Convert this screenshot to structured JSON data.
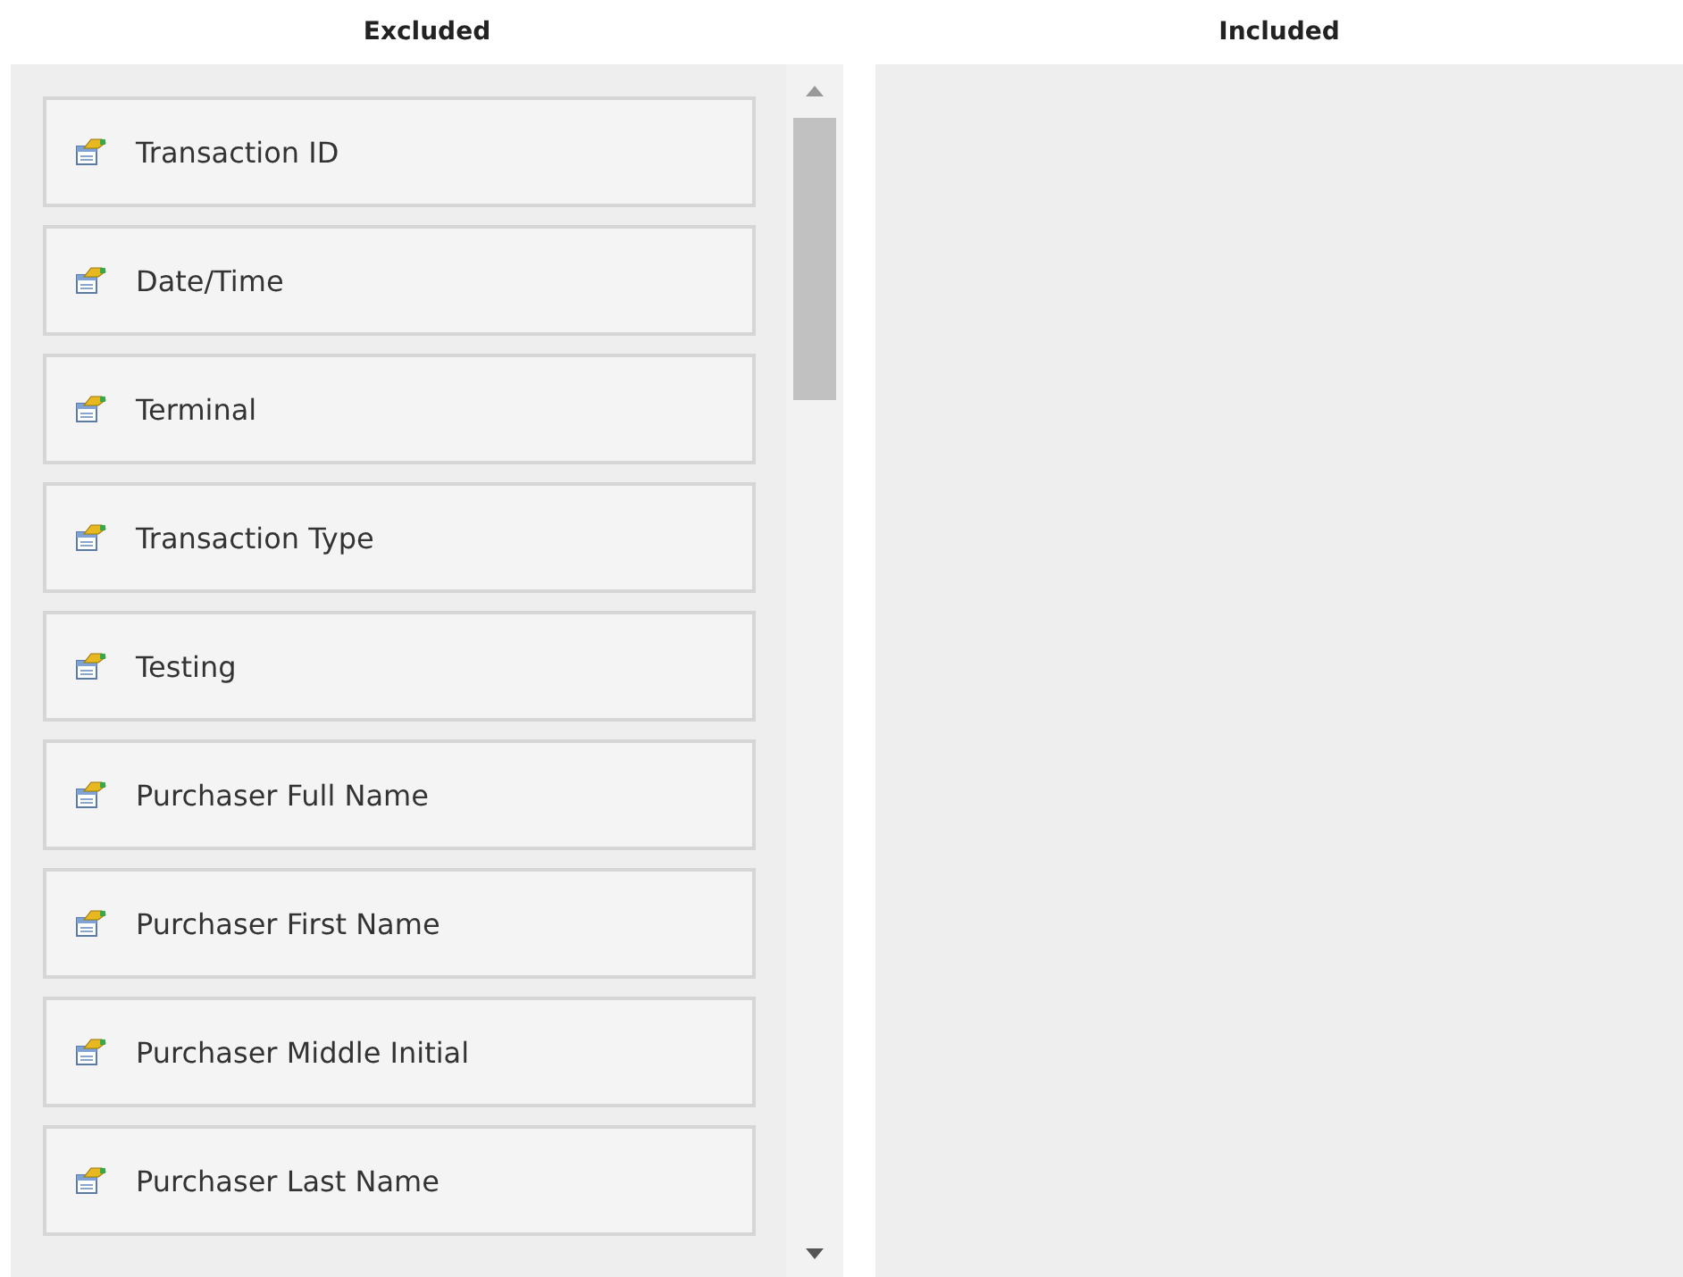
{
  "excluded": {
    "title": "Excluded",
    "items": [
      {
        "label": "Transaction ID"
      },
      {
        "label": "Date/Time"
      },
      {
        "label": "Terminal"
      },
      {
        "label": "Transaction Type"
      },
      {
        "label": "Testing"
      },
      {
        "label": "Purchaser Full Name"
      },
      {
        "label": "Purchaser First Name"
      },
      {
        "label": "Purchaser Middle Initial"
      },
      {
        "label": "Purchaser Last Name"
      }
    ]
  },
  "included": {
    "title": "Included"
  }
}
